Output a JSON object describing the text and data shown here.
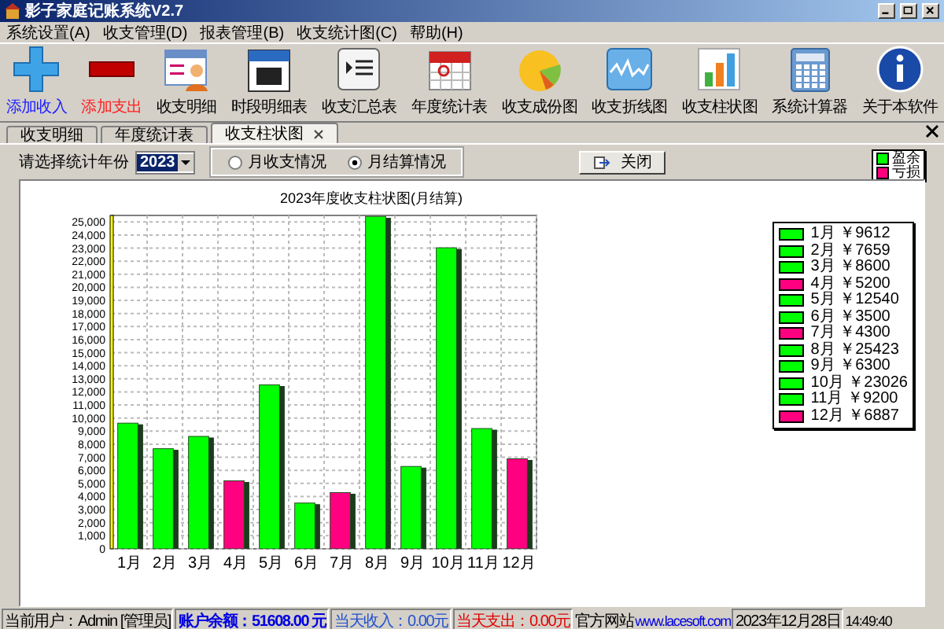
{
  "window": {
    "title": "影子家庭记账系统V2.7"
  },
  "menu": [
    {
      "label": "系统设置(A)"
    },
    {
      "label": "收支管理(D)"
    },
    {
      "label": "报表管理(B)"
    },
    {
      "label": "收支统计图(C)"
    },
    {
      "label": "帮助(H)"
    }
  ],
  "toolbar": [
    {
      "label": "添加收入",
      "kind": "plus",
      "color": "#2020ff"
    },
    {
      "label": "添加支出",
      "kind": "minus",
      "color": "#ff2020"
    },
    {
      "label": "收支明细",
      "kind": "card",
      "color": "#000000"
    },
    {
      "label": "时段明细表",
      "kind": "day",
      "color": "#000000"
    },
    {
      "label": "收支汇总表",
      "kind": "list",
      "color": "#000000"
    },
    {
      "label": "年度统计表",
      "kind": "calendar",
      "color": "#000000"
    },
    {
      "label": "收支成份图",
      "kind": "pie",
      "color": "#000000"
    },
    {
      "label": "收支折线图",
      "kind": "line",
      "color": "#000000"
    },
    {
      "label": "收支柱状图",
      "kind": "bars",
      "color": "#000000"
    },
    {
      "label": "系统计算器",
      "kind": "calc",
      "color": "#000000"
    },
    {
      "label": "关于本软件",
      "kind": "info",
      "color": "#000000"
    }
  ],
  "tabs": [
    {
      "label": "收支明细",
      "selected": false
    },
    {
      "label": "年度统计表",
      "selected": false
    },
    {
      "label": "收支柱状图",
      "selected": true
    }
  ],
  "filter": {
    "label": "请选择统计年份",
    "year": "2023",
    "options": [
      {
        "label": "月收支情况",
        "selected": false
      },
      {
        "label": "月结算情况",
        "selected": true
      }
    ],
    "close_button": "关闭"
  },
  "chart": {
    "chart_data": {
      "type": "bar",
      "title": "2023年度收支柱状图(月结算)",
      "stacked": true,
      "grid": true,
      "categories": [
        "1月",
        "2月",
        "3月",
        "4月",
        "5月",
        "6月",
        "7月",
        "8月",
        "9月",
        "10月",
        "11月",
        "12月"
      ],
      "series": [
        {
          "name": "盈余",
          "color": "#00ff00",
          "values": [
            9612,
            7659,
            8600,
            null,
            12540,
            3500,
            null,
            25423,
            6300,
            23026,
            9200,
            null
          ]
        },
        {
          "name": "亏损",
          "color": "#ff0080",
          "values": [
            null,
            null,
            null,
            5200,
            null,
            null,
            4300,
            null,
            null,
            null,
            null,
            6887
          ]
        }
      ],
      "ylim": [
        0,
        25500
      ],
      "yticks": [
        {
          "value": 0,
          "label": "0"
        },
        {
          "value": 1000,
          "label": "1,000"
        },
        {
          "value": 2000,
          "label": "2,000"
        },
        {
          "value": 3000,
          "label": "3,000"
        },
        {
          "value": 4000,
          "label": "4,000"
        },
        {
          "value": 5000,
          "label": "5,000"
        },
        {
          "value": 6000,
          "label": "6,000"
        },
        {
          "value": 7000,
          "label": "7,000"
        },
        {
          "value": 8000,
          "label": "8,000"
        },
        {
          "value": 9000,
          "label": "9,000"
        },
        {
          "value": 10000,
          "label": "10,000"
        },
        {
          "value": 11000,
          "label": "11,000"
        },
        {
          "value": 12000,
          "label": "12,000"
        },
        {
          "value": 13000,
          "label": "13,000"
        },
        {
          "value": 14000,
          "label": "14,000"
        },
        {
          "value": 15000,
          "label": "15,000"
        },
        {
          "value": 16000,
          "label": "16,000"
        },
        {
          "value": 17000,
          "label": "17,000"
        },
        {
          "value": 18000,
          "label": "18,000"
        },
        {
          "value": 19000,
          "label": "19,000"
        },
        {
          "value": 20000,
          "label": "20,000"
        },
        {
          "value": 21000,
          "label": "21,000"
        },
        {
          "value": 22000,
          "label": "22,000"
        },
        {
          "value": 23000,
          "label": "23,000"
        },
        {
          "value": 24000,
          "label": "24,000"
        },
        {
          "value": 25000,
          "label": "25,000"
        }
      ]
    },
    "legend": [
      {
        "label": "1月 ￥9612",
        "color": "#00ff00"
      },
      {
        "label": "2月 ￥7659",
        "color": "#00ff00"
      },
      {
        "label": "3月 ￥8600",
        "color": "#00ff00"
      },
      {
        "label": "4月 ￥5200",
        "color": "#ff0080"
      },
      {
        "label": "5月 ￥12540",
        "color": "#00ff00"
      },
      {
        "label": "6月 ￥3500",
        "color": "#00ff00"
      },
      {
        "label": "7月 ￥4300",
        "color": "#ff0080"
      },
      {
        "label": "8月 ￥25423",
        "color": "#00ff00"
      },
      {
        "label": "9月 ￥6300",
        "color": "#00ff00"
      },
      {
        "label": "10月 ￥23026",
        "color": "#00ff00"
      },
      {
        "label": "11月 ￥9200",
        "color": "#00ff00"
      },
      {
        "label": "12月 ￥6887",
        "color": "#ff0080"
      }
    ]
  },
  "status_bar": {
    "user": "当前用户：Admin [管理员]",
    "balance": "账户余额：51608.00 元",
    "income": "当天收入：0.00元",
    "expense": "当天支出：0.00元",
    "site_label": "官方网站",
    "site_url": "www.lacesoft.com",
    "date": "2023年12月28日",
    "time": "14:49:40"
  }
}
